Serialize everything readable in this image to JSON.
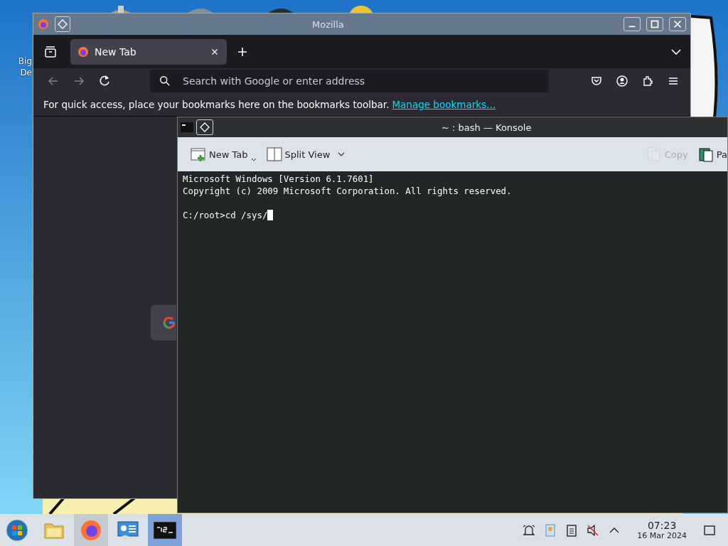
{
  "desktop": {
    "icon_label": [
      "Big",
      "De"
    ]
  },
  "firefox": {
    "title": "Mozilla",
    "tab": {
      "label": "New Tab",
      "selected": true
    },
    "nav": {
      "back_disabled": true,
      "forward_disabled": true
    },
    "address": {
      "placeholder": "Search with Google or enter address"
    },
    "bookmarks_bar": {
      "text": "For quick access, place your bookmarks here on the bookmarks toolbar.",
      "link": "Manage bookmarks…"
    }
  },
  "konsole": {
    "title": "~ : bash — Konsole",
    "toolbar": [
      {
        "label": "New Tab",
        "kind": "new-tab",
        "disabled": false
      },
      {
        "label": "Split View",
        "kind": "split",
        "disabled": false
      },
      {
        "label": "Copy",
        "kind": "copy",
        "disabled": true
      },
      {
        "label": "Pa",
        "kind": "paste",
        "disabled": false
      }
    ],
    "output": [
      "Microsoft Windows [Version 6.1.7601]",
      "Copyright (c) 2009 Microsoft Corporation. All rights reserved."
    ],
    "prompt": "C:/root>cd /sys/"
  },
  "taskbar": {
    "tasks": [
      {
        "kind": "start",
        "running": false,
        "selected": false
      },
      {
        "kind": "folder",
        "running": false,
        "selected": false
      },
      {
        "kind": "firefox",
        "running": true,
        "selected": false
      },
      {
        "kind": "remote",
        "running": false,
        "selected": false
      },
      {
        "kind": "terminal",
        "running": true,
        "selected": true
      }
    ],
    "clock": {
      "time": "07:23",
      "date": "16 Mar 2024"
    }
  }
}
